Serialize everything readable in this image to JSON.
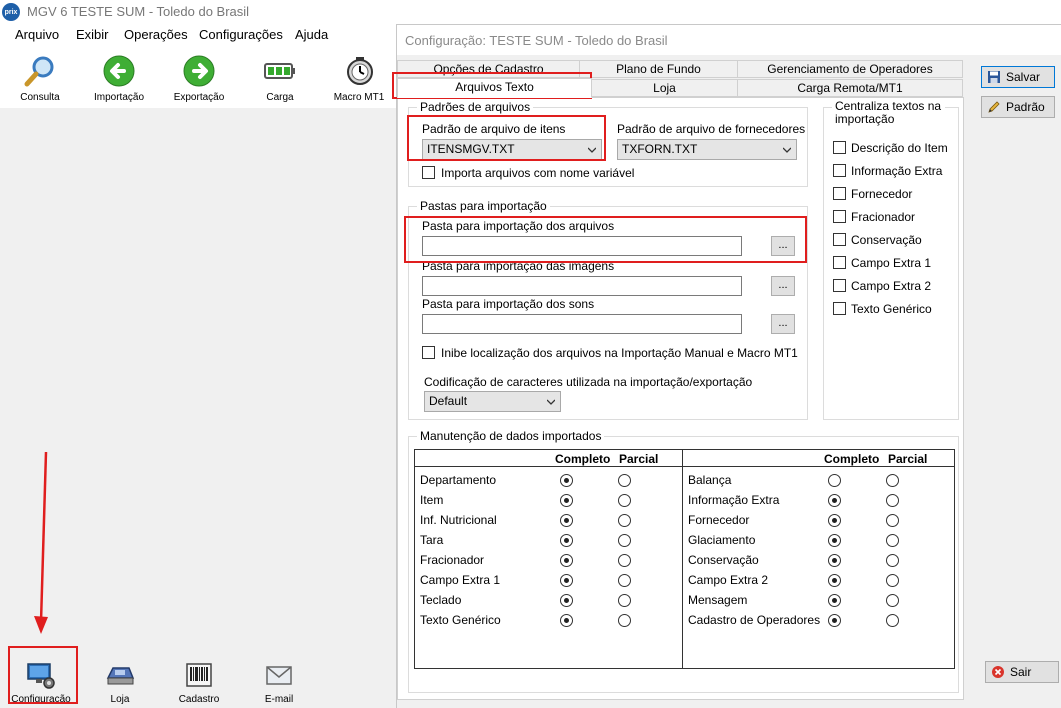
{
  "main_window": {
    "logo_text": "prix",
    "title": "MGV 6 TESTE SUM - Toledo do Brasil"
  },
  "menu": [
    "Arquivo",
    "Exibir",
    "Operações",
    "Configurações",
    "Ajuda"
  ],
  "toolbar": [
    {
      "label": "Consulta",
      "icon": "magnifier-icon"
    },
    {
      "label": "Importação",
      "icon": "arrow-left-icon"
    },
    {
      "label": "Exportação",
      "icon": "arrow-right-icon"
    },
    {
      "label": "Carga",
      "icon": "battery-icon"
    },
    {
      "label": "Macro MT1",
      "icon": "clock-icon"
    }
  ],
  "bottom_bar": [
    {
      "label": "Configuração",
      "icon": "monitor-gear-icon"
    },
    {
      "label": "Loja",
      "icon": "scale-icon"
    },
    {
      "label": "Cadastro",
      "icon": "barcode-icon"
    },
    {
      "label": "E-mail",
      "icon": "envelope-icon"
    }
  ],
  "dialog": {
    "title": "Configuração: TESTE SUM - Toledo do Brasil",
    "tabs_row1": [
      "Opções de Cadastro",
      "Plano de Fundo",
      "Gerenciamento de Operadores"
    ],
    "tabs_row2": [
      "Arquivos Texto",
      "Loja",
      "Carga Remota/MT1"
    ],
    "active_tab": "Arquivos Texto",
    "buttons": {
      "save": "Salvar",
      "default": "Padrão",
      "exit": "Sair"
    },
    "padroes": {
      "group_title": "Padrões de arquivos",
      "itens_label": "Padrão de arquivo de itens",
      "itens_value": "ITENSMGV.TXT",
      "fornecedores_label": "Padrão de arquivo de fornecedores",
      "fornecedores_value": "TXFORN.TXT",
      "variavel_label": "Importa arquivos com nome variável"
    },
    "pastas": {
      "group_title": "Pastas para importação",
      "arquivos_label": "Pasta para importação dos arquivos",
      "imagens_label": "Pasta para importação das imagens",
      "sons_label": "Pasta para importação dos sons",
      "browse": "...",
      "inibe_label": "Inibe localização dos arquivos na Importação Manual e Macro MT1",
      "codificacao_label": "Codificação de caracteres utilizada na importação/exportação",
      "codificacao_value": "Default"
    },
    "centraliza": {
      "group_title_1": "Centraliza textos na",
      "group_title_2": "importação",
      "items": [
        "Descrição do Item",
        "Informação Extra",
        "Fornecedor",
        "Fracionador",
        "Conservação",
        "Campo Extra 1",
        "Campo Extra 2",
        "Texto Genérico"
      ]
    },
    "manutencao": {
      "group_title": "Manutenção de dados importados",
      "col_completo": "Completo",
      "col_parcial": "Parcial",
      "left_rows": [
        {
          "label": "Departamento",
          "selected": "completo"
        },
        {
          "label": "Item",
          "selected": "completo"
        },
        {
          "label": "Inf. Nutricional",
          "selected": "completo"
        },
        {
          "label": "Tara",
          "selected": "completo"
        },
        {
          "label": "Fracionador",
          "selected": "completo"
        },
        {
          "label": "Campo Extra 1",
          "selected": "completo"
        },
        {
          "label": "Teclado",
          "selected": "completo"
        },
        {
          "label": "Texto Genérico",
          "selected": "completo"
        }
      ],
      "right_rows": [
        {
          "label": "Balança",
          "selected": "none"
        },
        {
          "label": "Informação Extra",
          "selected": "completo"
        },
        {
          "label": "Fornecedor",
          "selected": "completo"
        },
        {
          "label": "Glaciamento",
          "selected": "completo"
        },
        {
          "label": "Conservação",
          "selected": "completo"
        },
        {
          "label": "Campo Extra 2",
          "selected": "completo"
        },
        {
          "label": "Mensagem",
          "selected": "completo"
        },
        {
          "label": "Cadastro de Operadores",
          "selected": "completo"
        }
      ]
    }
  },
  "annotation_color": "#e01e1e"
}
